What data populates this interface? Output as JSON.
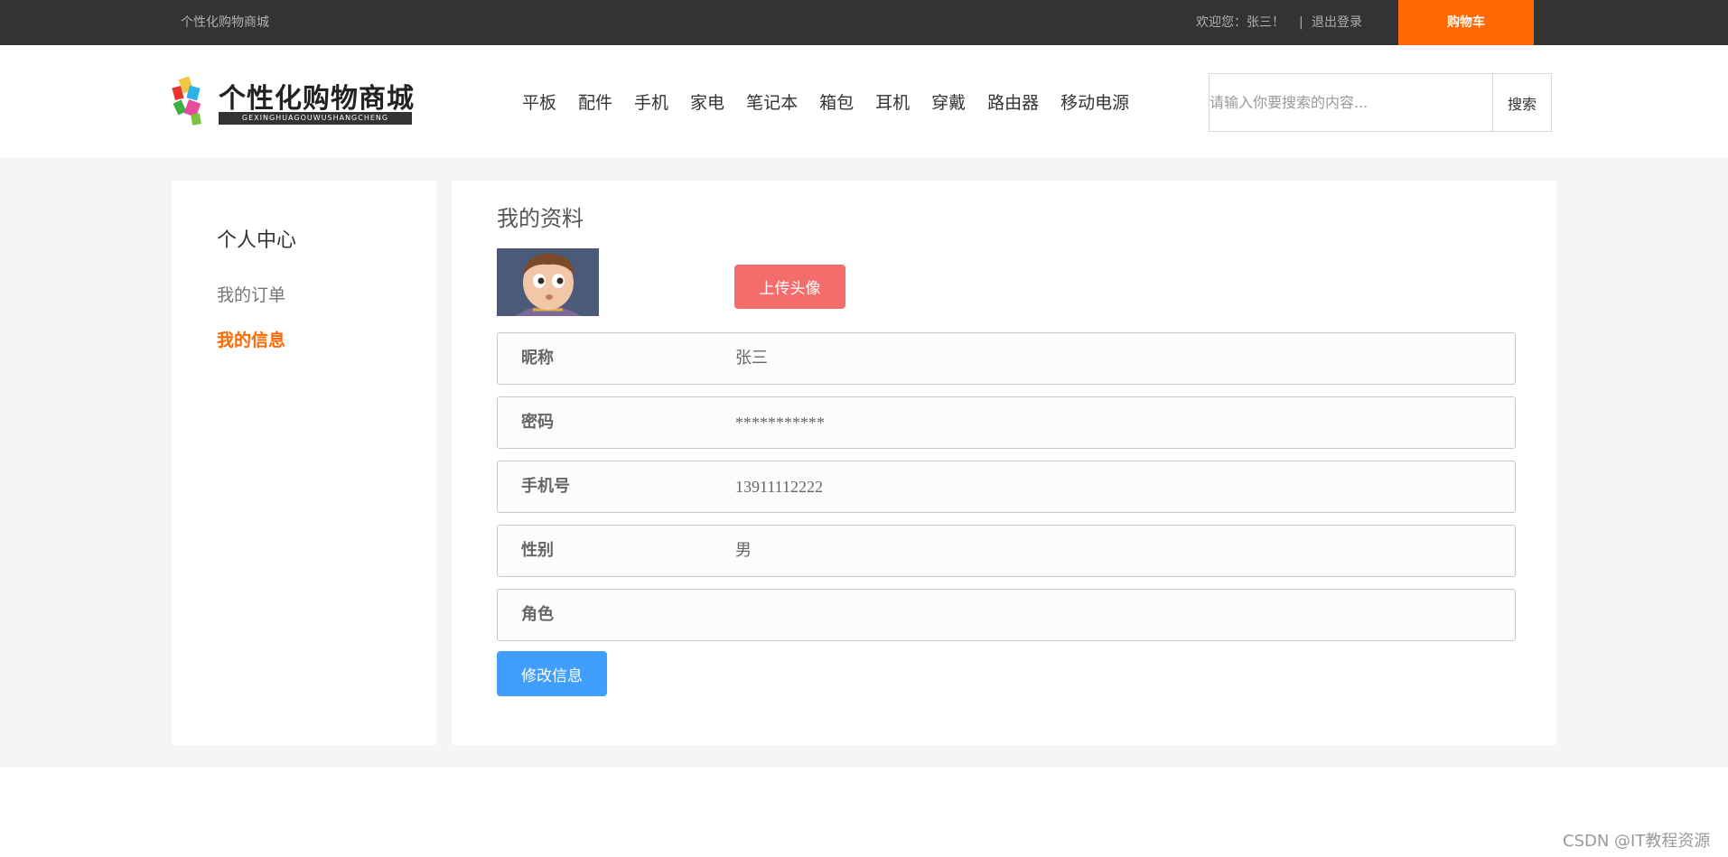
{
  "topbar": {
    "site_name": "个性化购物商城",
    "welcome": "欢迎您：张三！",
    "separator": "|",
    "logout": "退出登录",
    "cart": "购物车"
  },
  "header": {
    "logo_title": "个性化购物商城",
    "logo_sub": "GEXINGHUAGOUWUSHANGCHENG",
    "nav": [
      "平板",
      "配件",
      "手机",
      "家电",
      "笔记本",
      "箱包",
      "耳机",
      "穿戴",
      "路由器",
      "移动电源"
    ],
    "search_placeholder": "请输入你要搜索的内容...",
    "search_button": "搜索"
  },
  "sidebar": {
    "title": "个人中心",
    "items": [
      {
        "label": "我的订单",
        "active": false
      },
      {
        "label": "我的信息",
        "active": true
      }
    ]
  },
  "profile": {
    "title": "我的资料",
    "upload_button": "上传头像",
    "fields": [
      {
        "label": "昵称",
        "value": "张三"
      },
      {
        "label": "密码",
        "value": "***********"
      },
      {
        "label": "手机号",
        "value": "13911112222"
      },
      {
        "label": "性别",
        "value": "男"
      },
      {
        "label": "角色",
        "value": ""
      }
    ],
    "edit_button": "修改信息"
  },
  "watermark": "CSDN @IT教程资源",
  "colors": {
    "topbar_bg": "#333333",
    "accent_orange": "#ff6700",
    "upload_red": "#f56c6c",
    "edit_blue": "#409eff",
    "band_bg": "#f5f5f5"
  }
}
